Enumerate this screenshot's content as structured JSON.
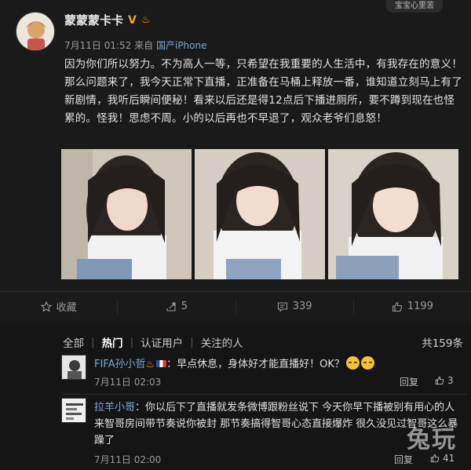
{
  "post": {
    "top_badge": "宝宝心里苦",
    "author": "蒙蒙蒙卡卡",
    "meta_time": "7月11日 01:52",
    "meta_from": "来自",
    "meta_source": "国产iPhone",
    "body": "因为你们所以努力。不为高人一等，只希望在我重要的人生活中，有我存在的意义！那么问题来了，我今天正常下直播，正准备在马桶上释放一番，谁知道立刻马上有了新剧情，我听后瞬间便秘！看来以后还是得12点后下播进厕所，要不蹲到现在也怪累的。怪我！思虑不周。小的以后再也不早退了，观众老爷们息怒！",
    "photos": [
      "photo-1",
      "photo-2",
      "photo-3"
    ],
    "actions": {
      "favorite": "收藏",
      "repost_count": "5",
      "comment_count": "339",
      "like_count": "1199"
    }
  },
  "comments": {
    "filters": [
      "全部",
      "热门",
      "认证用户",
      "关注的人"
    ],
    "active_filter": "热门",
    "total": "共159条",
    "items": [
      {
        "user": "FIFA孙小哲",
        "text": "：早点休息，身体好才能直播好！OK？",
        "time": "7月11日 02:03",
        "reply": "回复",
        "likes": "3"
      },
      {
        "user": "拉羊小哥",
        "text": "：你以后下了直播就发条微博跟粉丝说下 今天你早下播被别有用心的人来智哥房间带节奏说你被封 那节奏搞得智哥心态直接爆炸 很久没见过智哥这么暴躁了",
        "time": "7月11日 02:00",
        "reply": "回复",
        "likes": "41"
      }
    ]
  },
  "watermark": "兔玩",
  "colors": {
    "background": "#1a1a1a",
    "link": "#7aa6d6",
    "verified": "#f5a623"
  },
  "icons": [
    "star-icon",
    "repost-icon",
    "comment-icon",
    "thumbs-up-icon",
    "verified-v-icon",
    "fire-icon"
  ]
}
